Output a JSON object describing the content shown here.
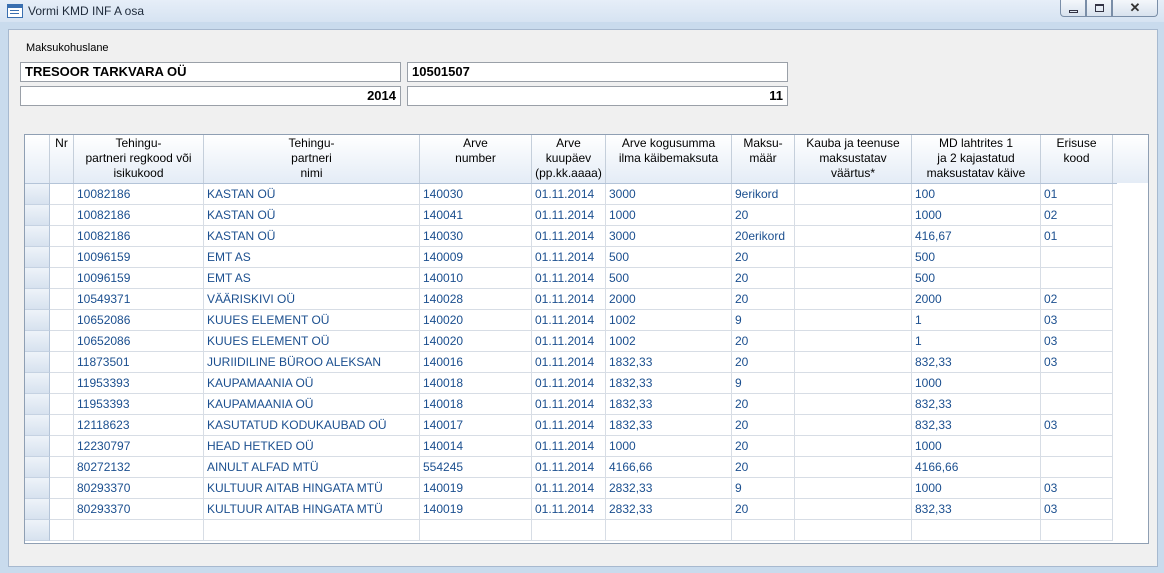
{
  "window": {
    "title": "Vormi KMD INF A osa"
  },
  "taxpayer": {
    "label": "Maksukohuslane",
    "name": "TRESOOR TARKVARA OÜ",
    "regcode": "10501507",
    "year": "2014",
    "month": "11"
  },
  "grid": {
    "headers": {
      "nr": "Nr",
      "partner_code": "Tehingu-\npartneri regkood või\nisikukood",
      "partner_name": "Tehingu-\npartneri\nnimi",
      "invoice_number": "Arve\nnumber",
      "invoice_date": "Arve\nkuupäev\n(pp.kk.aaaa)",
      "invoice_total": "Arve kogusumma\nilma käibemaksuta",
      "tax_rate": "Maksu-\nmäär",
      "taxable_value": "Kauba ja teenuse\nmaksustatav\nväärtus*",
      "md_turnover": "MD lahtrites 1\nja 2 kajastatud\nmaksustatav käive",
      "special_code": "Erisuse\nkood"
    },
    "rows": [
      {
        "nr": "",
        "partner_code": "10082186",
        "partner_name": "KASTAN OÜ",
        "invoice_number": "140030",
        "invoice_date": "01.11.2014",
        "invoice_total": "3000",
        "tax_rate": "9erikord",
        "taxable_value": "",
        "md_turnover": "100",
        "special_code": "01"
      },
      {
        "nr": "",
        "partner_code": "10082186",
        "partner_name": "KASTAN OÜ",
        "invoice_number": "140041",
        "invoice_date": "01.11.2014",
        "invoice_total": "1000",
        "tax_rate": "20",
        "taxable_value": "",
        "md_turnover": "1000",
        "special_code": "02"
      },
      {
        "nr": "",
        "partner_code": "10082186",
        "partner_name": "KASTAN OÜ",
        "invoice_number": "140030",
        "invoice_date": "01.11.2014",
        "invoice_total": "3000",
        "tax_rate": "20erikord",
        "taxable_value": "",
        "md_turnover": "416,67",
        "special_code": "01"
      },
      {
        "nr": "",
        "partner_code": "10096159",
        "partner_name": "EMT AS",
        "invoice_number": "140009",
        "invoice_date": "01.11.2014",
        "invoice_total": "500",
        "tax_rate": "20",
        "taxable_value": "",
        "md_turnover": "500",
        "special_code": ""
      },
      {
        "nr": "",
        "partner_code": "10096159",
        "partner_name": "EMT AS",
        "invoice_number": "140010",
        "invoice_date": "01.11.2014",
        "invoice_total": "500",
        "tax_rate": "20",
        "taxable_value": "",
        "md_turnover": "500",
        "special_code": ""
      },
      {
        "nr": "",
        "partner_code": "10549371",
        "partner_name": "VÄÄRISKIVI OÜ",
        "invoice_number": "140028",
        "invoice_date": "01.11.2014",
        "invoice_total": "2000",
        "tax_rate": "20",
        "taxable_value": "",
        "md_turnover": "2000",
        "special_code": "02"
      },
      {
        "nr": "",
        "partner_code": "10652086",
        "partner_name": "KUUES ELEMENT OÜ",
        "invoice_number": "140020",
        "invoice_date": "01.11.2014",
        "invoice_total": "1002",
        "tax_rate": "9",
        "taxable_value": "",
        "md_turnover": "1",
        "special_code": "03"
      },
      {
        "nr": "",
        "partner_code": "10652086",
        "partner_name": "KUUES ELEMENT OÜ",
        "invoice_number": "140020",
        "invoice_date": "01.11.2014",
        "invoice_total": "1002",
        "tax_rate": "20",
        "taxable_value": "",
        "md_turnover": "1",
        "special_code": "03"
      },
      {
        "nr": "",
        "partner_code": "11873501",
        "partner_name": "JURIIDILINE BÜROO ALEKSAN",
        "invoice_number": "140016",
        "invoice_date": "01.11.2014",
        "invoice_total": "1832,33",
        "tax_rate": "20",
        "taxable_value": "",
        "md_turnover": "832,33",
        "special_code": "03"
      },
      {
        "nr": "",
        "partner_code": "11953393",
        "partner_name": "KAUPAMAANIA OÜ",
        "invoice_number": "140018",
        "invoice_date": "01.11.2014",
        "invoice_total": "1832,33",
        "tax_rate": "9",
        "taxable_value": "",
        "md_turnover": "1000",
        "special_code": ""
      },
      {
        "nr": "",
        "partner_code": "11953393",
        "partner_name": "KAUPAMAANIA OÜ",
        "invoice_number": "140018",
        "invoice_date": "01.11.2014",
        "invoice_total": "1832,33",
        "tax_rate": "20",
        "taxable_value": "",
        "md_turnover": "832,33",
        "special_code": ""
      },
      {
        "nr": "",
        "partner_code": "12118623",
        "partner_name": "KASUTATUD KODUKAUBAD OÜ",
        "invoice_number": "140017",
        "invoice_date": "01.11.2014",
        "invoice_total": "1832,33",
        "tax_rate": "20",
        "taxable_value": "",
        "md_turnover": "832,33",
        "special_code": "03"
      },
      {
        "nr": "",
        "partner_code": "12230797",
        "partner_name": "HEAD HETKED OÜ",
        "invoice_number": "140014",
        "invoice_date": "01.11.2014",
        "invoice_total": "1000",
        "tax_rate": "20",
        "taxable_value": "",
        "md_turnover": "1000",
        "special_code": ""
      },
      {
        "nr": "",
        "partner_code": "80272132",
        "partner_name": "AINULT ALFAD MTÜ",
        "invoice_number": "554245",
        "invoice_date": "01.11.2014",
        "invoice_total": "4166,66",
        "tax_rate": "20",
        "taxable_value": "",
        "md_turnover": "4166,66",
        "special_code": ""
      },
      {
        "nr": "",
        "partner_code": "80293370",
        "partner_name": "KULTUUR AITAB HINGATA MTÜ",
        "invoice_number": "140019",
        "invoice_date": "01.11.2014",
        "invoice_total": "2832,33",
        "tax_rate": "9",
        "taxable_value": "",
        "md_turnover": "1000",
        "special_code": "03"
      },
      {
        "nr": "",
        "partner_code": "80293370",
        "partner_name": "KULTUUR AITAB HINGATA MTÜ",
        "invoice_number": "140019",
        "invoice_date": "01.11.2014",
        "invoice_total": "2832,33",
        "tax_rate": "20",
        "taxable_value": "",
        "md_turnover": "832,33",
        "special_code": "03"
      },
      {
        "nr": "",
        "partner_code": "",
        "partner_name": "",
        "invoice_number": "",
        "invoice_date": "",
        "invoice_total": "",
        "tax_rate": "",
        "taxable_value": "",
        "md_turnover": "",
        "special_code": ""
      }
    ]
  },
  "colors": {
    "cell_text": "#1b4f8f",
    "frame": "#c9dbed"
  }
}
